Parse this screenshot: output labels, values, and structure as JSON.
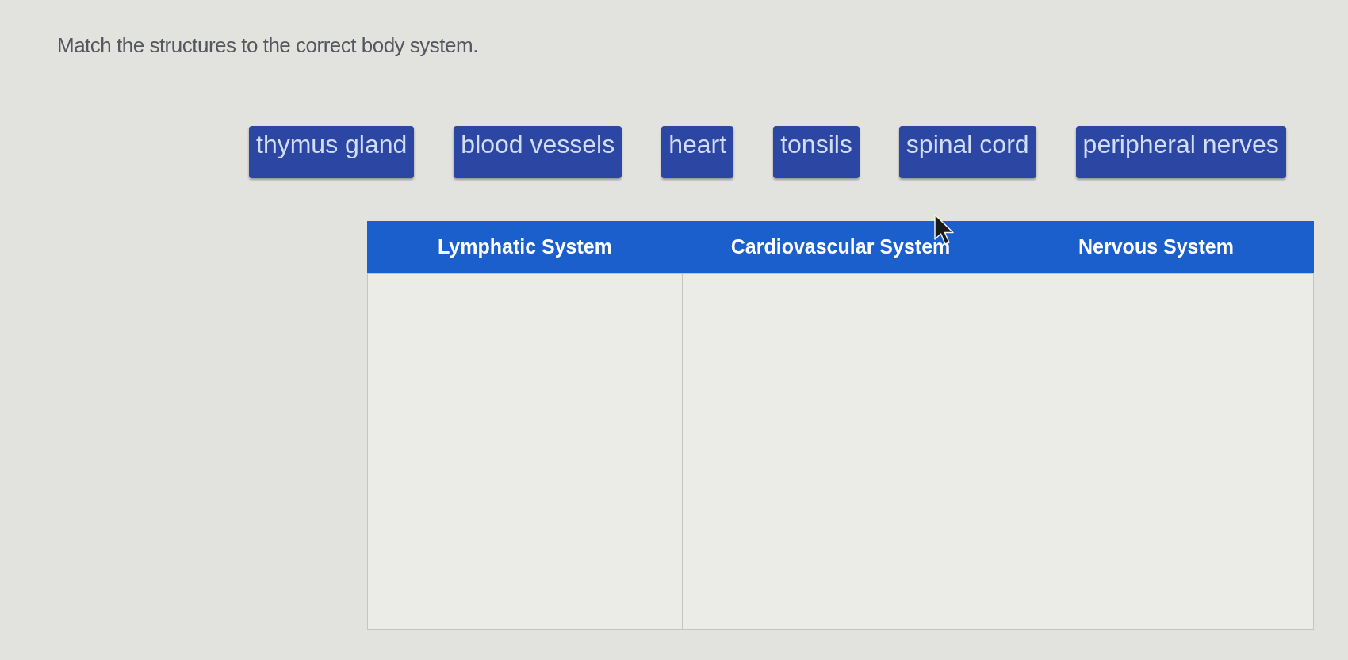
{
  "instruction": "Match the structures to the correct body system.",
  "tiles": [
    {
      "label": "thymus gland"
    },
    {
      "label": "blood vessels"
    },
    {
      "label": "heart"
    },
    {
      "label": "tonsils"
    },
    {
      "label": "spinal cord"
    },
    {
      "label": "peripheral nerves"
    }
  ],
  "table": {
    "columns": [
      {
        "header": "Lymphatic System"
      },
      {
        "header": "Cardiovascular System"
      },
      {
        "header": "Nervous System"
      }
    ]
  }
}
